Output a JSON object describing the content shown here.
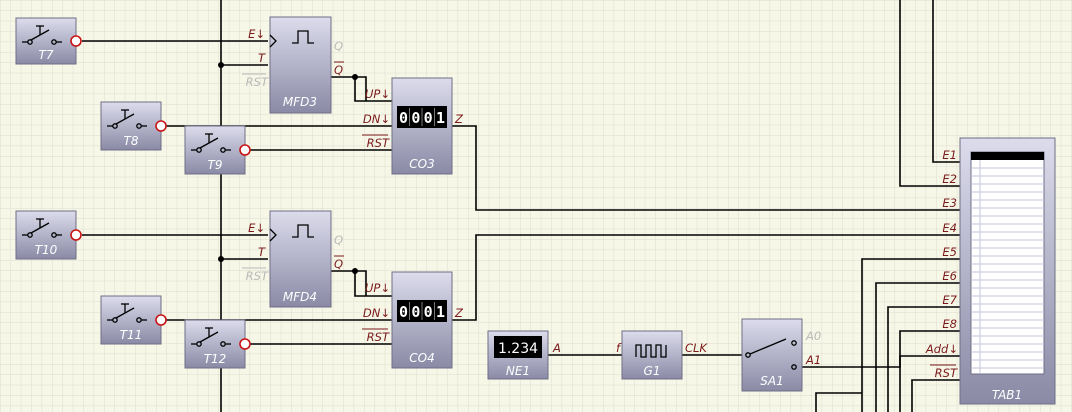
{
  "toggles": [
    {
      "id": "t7",
      "label": "T7"
    },
    {
      "id": "t8",
      "label": "T8"
    },
    {
      "id": "t9",
      "label": "T9"
    },
    {
      "id": "t10",
      "label": "T10"
    },
    {
      "id": "t11",
      "label": "T11"
    },
    {
      "id": "t12",
      "label": "T12"
    }
  ],
  "monoflops": [
    {
      "id": "mfd3",
      "label": "MFD3",
      "pins": {
        "e": "E↓",
        "t": "T",
        "rst": "RST",
        "q": "Q",
        "qbar": "Q"
      }
    },
    {
      "id": "mfd4",
      "label": "MFD4",
      "pins": {
        "e": "E↓",
        "t": "T",
        "rst": "RST",
        "q": "Q",
        "qbar": "Q"
      }
    }
  ],
  "counters": [
    {
      "id": "co3",
      "label": "CO3",
      "value": "0001",
      "pins": {
        "up": "UP↓",
        "dn": "DN↓",
        "rst": "RST",
        "z": "Z"
      }
    },
    {
      "id": "co4",
      "label": "CO4",
      "value": "0001",
      "pins": {
        "up": "UP↓",
        "dn": "DN↓",
        "rst": "RST",
        "z": "Z"
      }
    }
  ],
  "ne1": {
    "label": "NE1",
    "value": "1.234",
    "pin": "A"
  },
  "g1": {
    "label": "G1",
    "pin_in": "f",
    "pin_out": "CLK"
  },
  "sa1": {
    "label": "SA1",
    "pin_a0": "A0",
    "pin_a1": "A1"
  },
  "tab1": {
    "label": "TAB1",
    "pins": [
      "E1",
      "E2",
      "E3",
      "E4",
      "E5",
      "E6",
      "E7",
      "E8",
      "Add↓",
      "RST"
    ]
  },
  "colors": {
    "background": "#f7f7e8",
    "grid": "#deded0",
    "block_fill_top": "#dcdcec",
    "block_fill_bottom": "#8a8aa6",
    "pin_label": "#7a1a1a",
    "disabled_pin": "#b9b9b9",
    "output_circle": "#c81414",
    "wire": "#000000"
  }
}
